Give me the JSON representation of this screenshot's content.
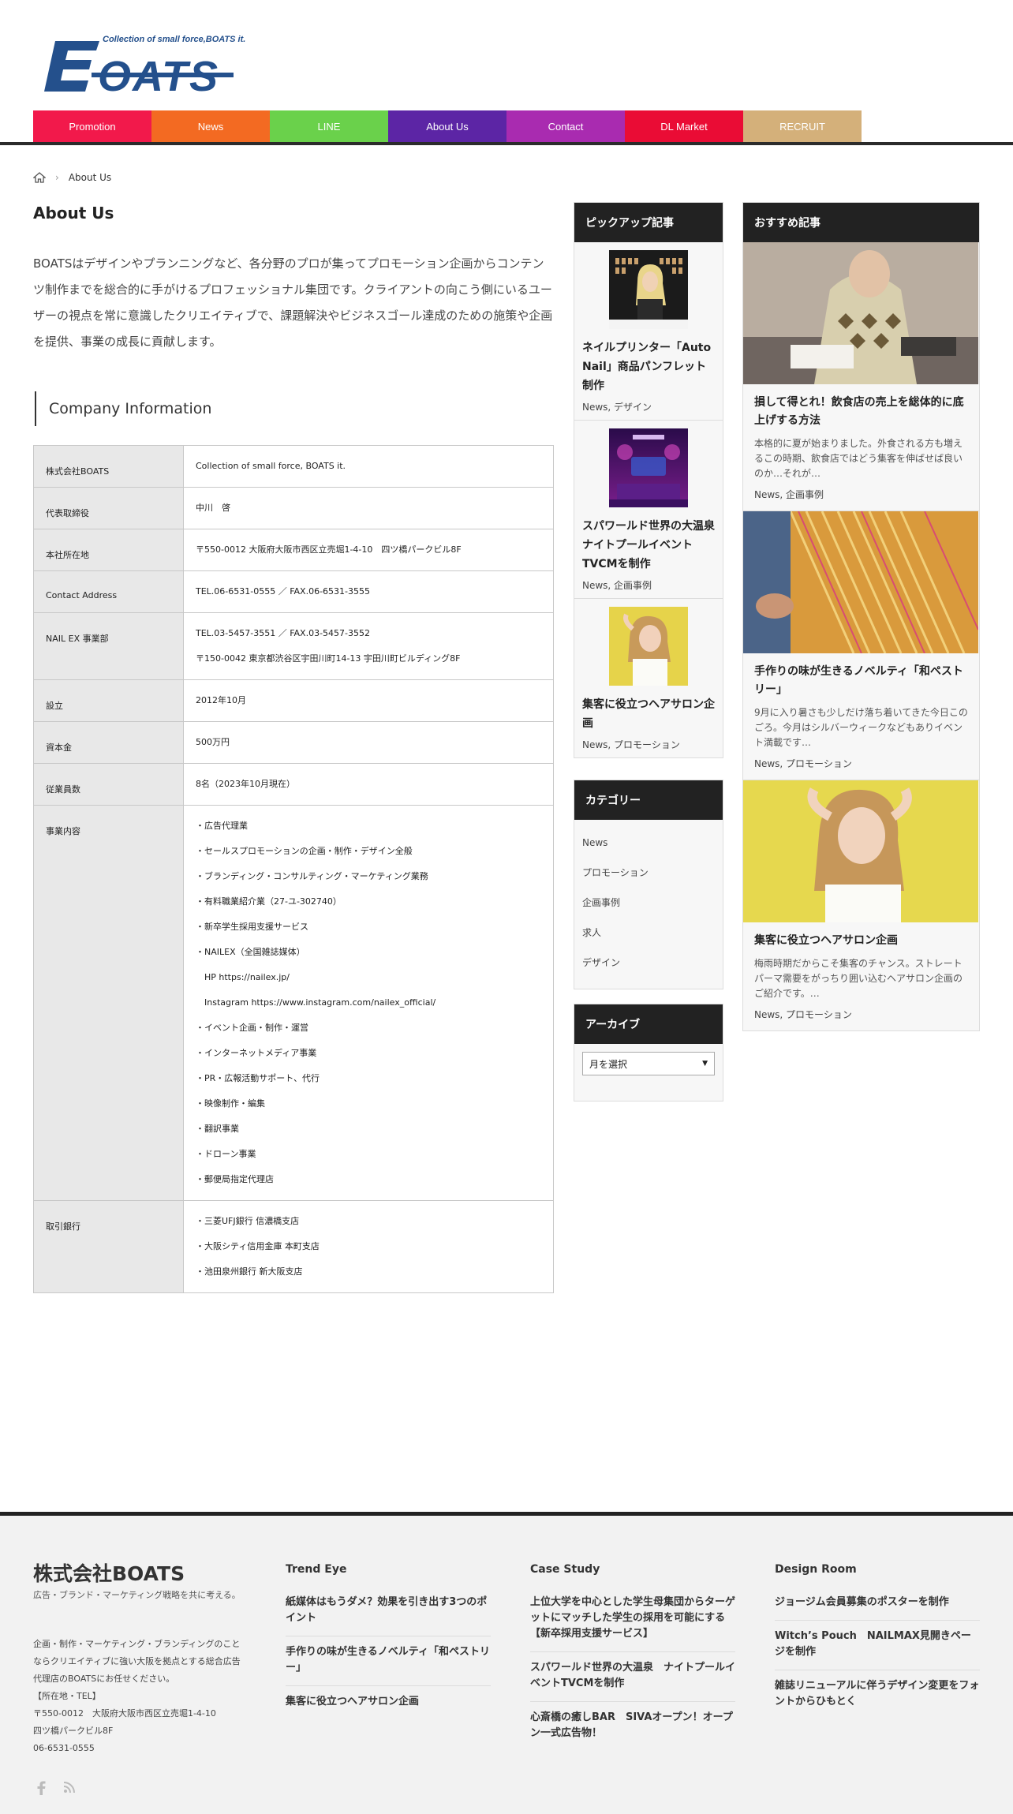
{
  "logo": {
    "tagline": "Collection of small force,BOATS it.",
    "wordmark": "BOATS"
  },
  "nav": [
    {
      "label": "Promotion",
      "color": "#f2194b"
    },
    {
      "label": "News",
      "color": "#f36a22"
    },
    {
      "label": "LINE",
      "color": "#6ad14b"
    },
    {
      "label": "About Us",
      "color": "#5c25a5"
    },
    {
      "label": "Contact",
      "color": "#a92bb0"
    },
    {
      "label": "DL Market",
      "color": "#ea0c35"
    },
    {
      "label": "RECRUIT",
      "color": "#d4b07a"
    }
  ],
  "breadcrumb": {
    "home_icon": "home-icon",
    "separator": "›",
    "current": "About Us"
  },
  "page": {
    "title": "About Us",
    "intro": "BOATSはデザインやプランニングなど、各分野のプロが集ってプロモーション企画からコンテンツ制作までを総合的に手がけるプロフェッショナル集団です。クライアントの向こう側にいるユーザーの視点を常に意識したクリエイティブで、課題解決やビジネスゴール達成のための施策や企画を提供、事業の成長に貢献します。",
    "section_heading": "Company Information"
  },
  "company_table": [
    {
      "label": "株式会社BOATS",
      "values": [
        "Collection of small force, BOATS it."
      ]
    },
    {
      "label": "代表取締役",
      "values": [
        "中川　啓"
      ]
    },
    {
      "label": "本社所在地",
      "values": [
        "〒550-0012 大阪府大阪市西区立売堀1-4-10　四ツ橋パークビル8F"
      ]
    },
    {
      "label": "Contact Address",
      "values": [
        "TEL.06-6531-0555 ／ FAX.06-6531-3555"
      ]
    },
    {
      "label": "NAIL EX 事業部",
      "values": [
        "TEL.03-5457-3551 ／ FAX.03-5457-3552",
        "〒150-0042 東京都渋谷区宇田川町14-13 宇田川町ビルディング8F"
      ]
    },
    {
      "label": "設立",
      "values": [
        "2012年10月"
      ]
    },
    {
      "label": "資本金",
      "values": [
        "500万円"
      ]
    },
    {
      "label": "従業員数",
      "values": [
        "8名（2023年10月現在）"
      ]
    },
    {
      "label": "事業内容",
      "values": [
        "・広告代理業",
        "・セールスプロモーションの企画・制作・デザイン全般",
        "・ブランディング・コンサルティング・マーケティング業務",
        "・有料職業紹介業（27-ユ-302740）",
        "・新卒学生採用支援サービス",
        "・NAILEX（全国雑誌媒体）",
        "　HP https://nailex.jp/",
        "　Instagram https://www.instagram.com/nailex_official/",
        "・イベント企画・制作・運営",
        "・インターネットメディア事業",
        "・PR・広報活動サポート、代行",
        "・映像制作・編集",
        "・翻訳事業",
        "・ドローン事業",
        "・郵便局指定代理店"
      ]
    },
    {
      "label": "取引銀行",
      "values": [
        "・三菱UFJ銀行 信濃橋支店",
        "・大阪シティ信用金庫 本町支店",
        "・池田泉州銀行 新大阪支店"
      ]
    }
  ],
  "pickup": {
    "title": "ピックアップ記事",
    "items": [
      {
        "title": "ネイルプリンター「Auto Nail」商品パンフレット制作",
        "meta": "News, デザイン"
      },
      {
        "title": "スパワールド世界の大温泉 ナイトプールイベントTVCMを制作",
        "meta": "News, 企画事例"
      },
      {
        "title": "集客に役立つヘアサロン企画",
        "meta": "News, プロモーション"
      }
    ]
  },
  "categories": {
    "title": "カテゴリー",
    "items": [
      "News",
      "プロモーション",
      "企画事例",
      "求人",
      "デザイン"
    ]
  },
  "archive": {
    "title": "アーカイブ",
    "select_label": "月を選択"
  },
  "recommended": {
    "title": "おすすめ記事",
    "items": [
      {
        "title": "損して得とれ！飲食店の売上を総体的に底上げする方法",
        "excerpt": "本格的に夏が始まりました。外食される方も増えるこの時期、飲食店ではどう集客を伸ばせば良いのか…それが…",
        "meta": "News, 企画事例"
      },
      {
        "title": "手作りの味が生きるノベルティ「和ペストリー」",
        "excerpt": "9月に入り暑さも少しだけ落ち着いてきた今日このごろ。今月はシルバーウィークなどもありイベント満載です…",
        "meta": "News, プロモーション"
      },
      {
        "title": "集客に役立つヘアサロン企画",
        "excerpt": "梅雨時期だからこそ集客のチャンス。ストレートパーマ需要をがっちり囲い込むヘアサロン企画のご紹介です。…",
        "meta": "News, プロモーション"
      }
    ]
  },
  "footer": {
    "company": "株式会社BOATS",
    "tagline": "広告・ブランド・マーケティング戦略を共に考える。",
    "description": [
      "企画・制作・マーケティング・ブランディングのことならクリエイティブに強い大阪を拠点とする総合広告代理店のBOATSにお任せください。",
      "【所在地・TEL】",
      "〒550-0012　大阪府大阪市西区立売堀1-4-10",
      "四ツ橋パークビル8F",
      "06-6531-0555"
    ],
    "columns": [
      {
        "title": "Trend Eye",
        "links": [
          "紙媒体はもうダメ？効果を引き出す3つのポイント",
          "手作りの味が生きるノベルティ「和ペストリー」",
          "集客に役立つヘアサロン企画"
        ]
      },
      {
        "title": "Case Study",
        "links": [
          "上位大学を中心とした学生母集団からターゲットにマッチした学生の採用を可能にする【新卒採用支援サービス】",
          "スパワールド世界の大温泉　ナイトプールイベントTVCMを制作",
          "心斎橋の癒しBAR　SIVAオープン！オープン一式広告物！"
        ]
      },
      {
        "title": "Design Room",
        "links": [
          "ジョージム会員募集のポスターを制作",
          "Witch’s Pouch　NAILMAX見開きページを制作",
          "雑誌リニューアルに伴うデザイン変更をフォントからひもとく"
        ]
      }
    ],
    "social": [
      "facebook-icon",
      "rss-icon"
    ]
  }
}
